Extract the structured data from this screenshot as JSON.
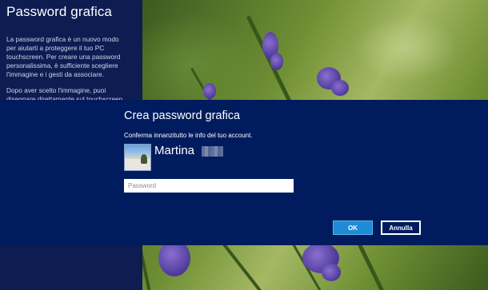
{
  "left_panel": {
    "title": "Password grafica",
    "paragraph_1": "La password grafica è un nuovo modo per aiutarti a proteggere il tuo PC touchscreen. Per creare una password personalissima, è sufficiente scegliere l'immagine e i gesti da associare.",
    "paragraph_2": "Dopo aver scelto l'immagine, puoi disegnare direttamente sul touchscreen"
  },
  "dialog": {
    "title": "Crea password grafica",
    "subtitle": "Conferma innanzitutto le info del tuo account.",
    "user_name": "Martina",
    "password_placeholder": "Password",
    "ok_label": "OK",
    "cancel_label": "Annulla"
  },
  "colors": {
    "dialog_background": "#001c5e",
    "panel_background": "#0d1d52",
    "ok_button": "#1d8bd6"
  }
}
